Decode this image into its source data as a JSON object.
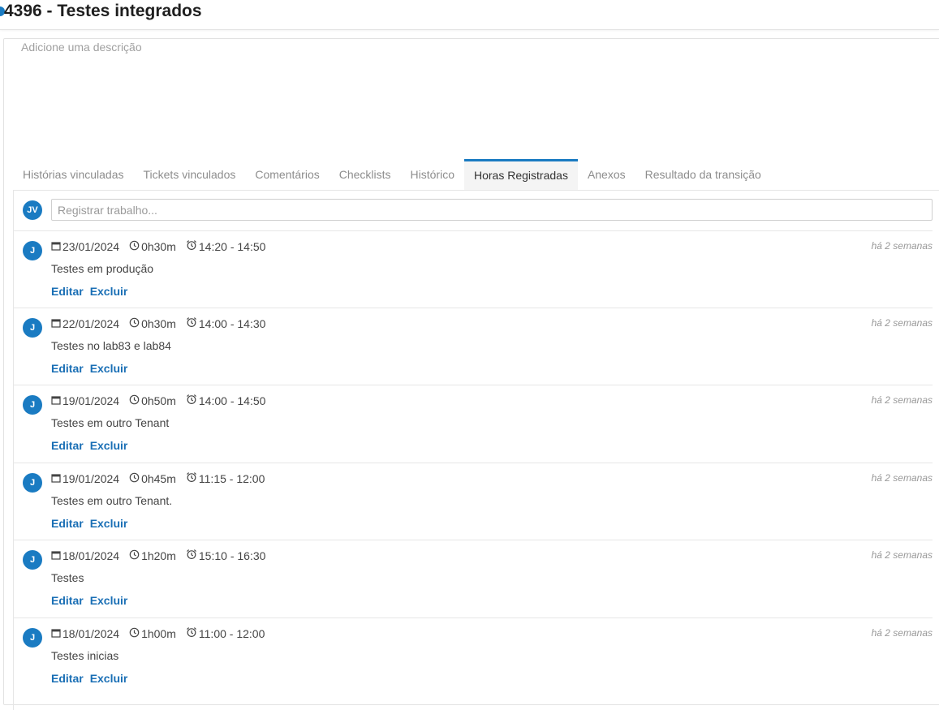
{
  "header": {
    "title": "4396 - Testes integrados"
  },
  "description_placeholder": "Adicione uma descrição",
  "tabs": [
    {
      "label": "Histórias vinculadas",
      "active": false
    },
    {
      "label": "Tickets vinculados",
      "active": false
    },
    {
      "label": "Comentários",
      "active": false
    },
    {
      "label": "Checklists",
      "active": false
    },
    {
      "label": "Histórico",
      "active": false
    },
    {
      "label": "Horas Registradas",
      "active": true
    },
    {
      "label": "Anexos",
      "active": false
    },
    {
      "label": "Resultado da transição",
      "active": false
    }
  ],
  "worklog": {
    "current_user_initials": "JV",
    "input_placeholder": "Registrar trabalho...",
    "edit_label": "Editar",
    "delete_label": "Excluir",
    "entries": [
      {
        "avatar": "J",
        "date": "23/01/2024",
        "duration": "0h30m",
        "time_range": "14:20 - 14:50",
        "description": "Testes em produção",
        "ago": "há 2 semanas"
      },
      {
        "avatar": "J",
        "date": "22/01/2024",
        "duration": "0h30m",
        "time_range": "14:00 - 14:30",
        "description": "Testes no lab83 e lab84",
        "ago": "há 2 semanas"
      },
      {
        "avatar": "J",
        "date": "19/01/2024",
        "duration": "0h50m",
        "time_range": "14:00 - 14:50",
        "description": "Testes em outro Tenant",
        "ago": "há 2 semanas"
      },
      {
        "avatar": "J",
        "date": "19/01/2024",
        "duration": "0h45m",
        "time_range": "11:15 - 12:00",
        "description": "Testes em outro Tenant.",
        "ago": "há 2 semanas"
      },
      {
        "avatar": "J",
        "date": "18/01/2024",
        "duration": "1h20m",
        "time_range": "15:10 - 16:30",
        "description": "Testes",
        "ago": "há 2 semanas"
      },
      {
        "avatar": "J",
        "date": "18/01/2024",
        "duration": "1h00m",
        "time_range": "11:00 - 12:00",
        "description": "Testes inicias",
        "ago": "há 2 semanas"
      }
    ]
  },
  "icons": {
    "date": "calendar-icon",
    "duration": "clock-icon",
    "time_range": "alarm-clock-icon"
  },
  "colors": {
    "accent": "#1a7bc2",
    "link": "#1a6fb5"
  }
}
